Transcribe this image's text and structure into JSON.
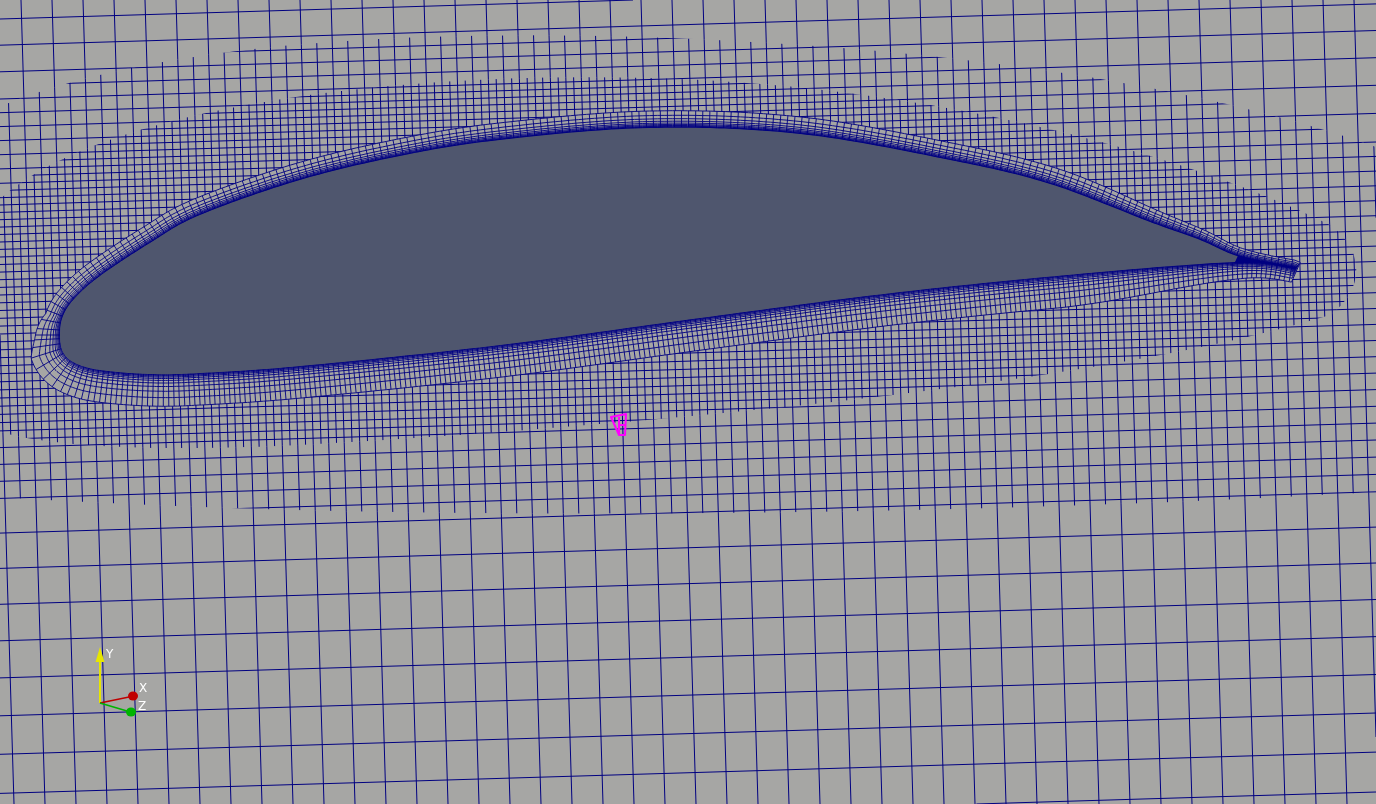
{
  "viewport": {
    "axes_triad": [
      {
        "kind": "vertical",
        "label": "Y",
        "color": "#e6e600"
      },
      {
        "kind": "horizontal",
        "label": "X",
        "color": "#c00000"
      },
      {
        "kind": "depth",
        "label": "Z",
        "color": "#00b400"
      }
    ]
  }
}
